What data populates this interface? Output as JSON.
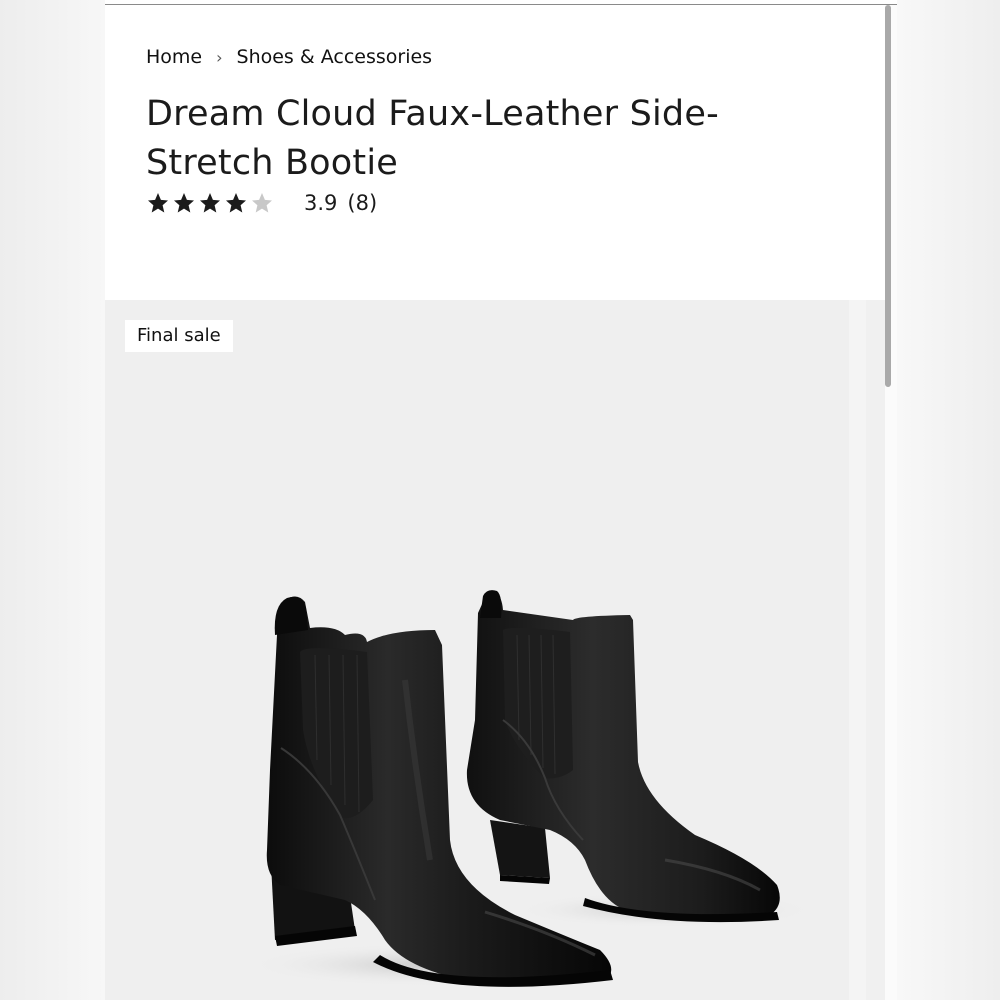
{
  "breadcrumb": {
    "items": [
      "Home",
      "Shoes & Accessories"
    ]
  },
  "product": {
    "title": "Dream Cloud Faux-Leather Side-Stretch Bootie",
    "rating": {
      "value": "3.9",
      "count": "(8)",
      "stars_filled": 4,
      "stars_total": 5
    },
    "badge": "Final sale",
    "image": "black-ankle-chelsea-boots"
  },
  "colors": {
    "star_filled": "#1b1b1b",
    "star_empty": "#c8c8c8",
    "gallery_bg": "#efefef"
  }
}
